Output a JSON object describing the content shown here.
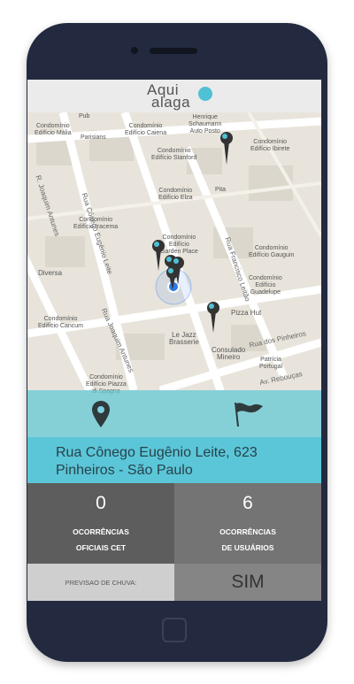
{
  "app": {
    "logo_line1": "Aqui",
    "logo_line2": "alaga"
  },
  "map": {
    "places": [
      "Pub",
      "Condomínio\nEdifício Caiena",
      "Henrique\nSchaumann\nAuto Posto",
      "Condomínio\nEdifício Stanford",
      "Condomínio\nEdifício Ibirete",
      "Pita",
      "Condomínio\nEdifício Elza",
      "Condomínio\nEdifício Iracema",
      "Condomínio\nEdifício\nGarden Place",
      "Diversa",
      "Condomínio\nEdifício Gauguin",
      "Condomínio\nEdifício\nGuadelupe",
      "Condomínio\nEdifício Cancum",
      "Pizza Hut",
      "Le Jazz\nBrasserie",
      "Consulado\nMineiro",
      "Patrícia\nPortugal",
      "Condomínio\nEdifício Piazza\ndi Spagna",
      "Parisians",
      "Condomínio\nEdifício Mália",
      "Rebouças\nConvenções",
      "Condomínio\nEdifício Emília"
    ],
    "streets": [
      "Rua Cônego Eugênio Leite",
      "R. Joaquim Antunes",
      "Rua Joaquim Antunes",
      "Rua Francisco Leitão",
      "Rua dos Pinheiros",
      "Av. Rebouças",
      "Rua Cônego",
      "Rua Sezefredo",
      "Rua dos Pinheiros",
      "Rua Cônego"
    ],
    "pins": [
      "marker-1",
      "marker-2",
      "marker-3",
      "marker-4",
      "marker-5",
      "marker-6"
    ]
  },
  "actions": {
    "location": "location-pin-icon",
    "flag": "flag-icon"
  },
  "address": {
    "line1": "Rua Cônego Eugênio Leite, 623",
    "line2": "Pinheiros - São Paulo"
  },
  "stats": [
    {
      "count": "0",
      "label1": "OCORRÊNCIAS",
      "label2": "OFICIAIS CET"
    },
    {
      "count": "6",
      "label1": "OCORRÊNCIAS",
      "label2": "DE USUÁRIOS"
    }
  ],
  "rain": {
    "label": "PREVISAO DE CHUVA:",
    "value": "SIM"
  },
  "colors": {
    "teal": "#5bc6d8",
    "dark_stat": "#5d5d5d",
    "mid_stat": "#757575",
    "phone": "#232a3f"
  }
}
